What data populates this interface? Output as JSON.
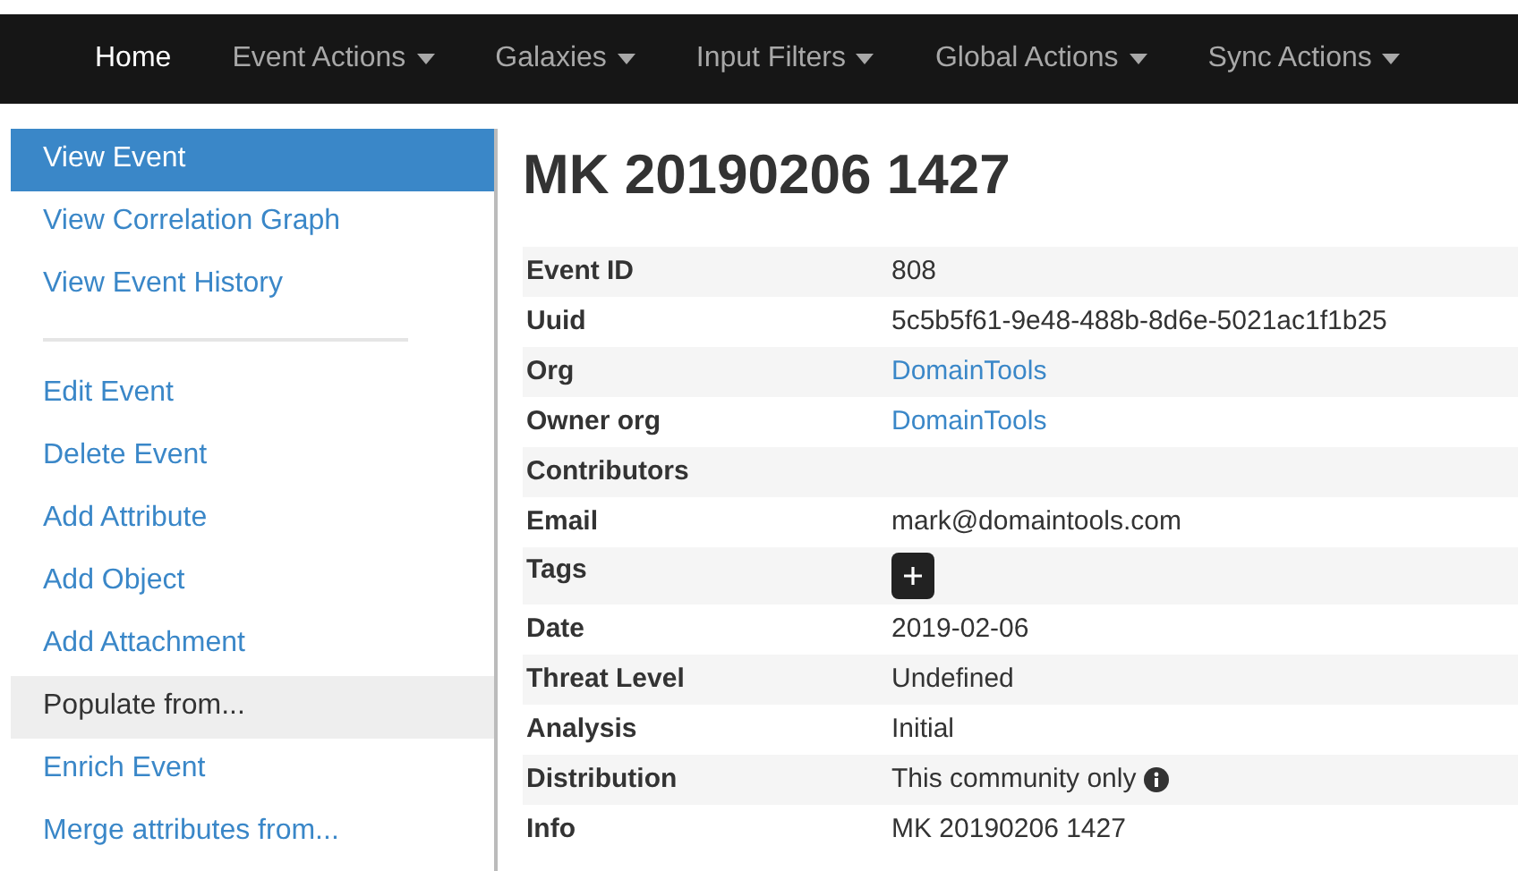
{
  "navbar": {
    "items": [
      {
        "label": "Home",
        "selected": true,
        "dropdown": false
      },
      {
        "label": "Event Actions",
        "selected": false,
        "dropdown": true
      },
      {
        "label": "Galaxies",
        "selected": false,
        "dropdown": true
      },
      {
        "label": "Input Filters",
        "selected": false,
        "dropdown": true
      },
      {
        "label": "Global Actions",
        "selected": false,
        "dropdown": true
      },
      {
        "label": "Sync Actions",
        "selected": false,
        "dropdown": true
      }
    ]
  },
  "sidebar": {
    "items": [
      {
        "kind": "link",
        "label": "View Event",
        "selected": true,
        "highlighted": false
      },
      {
        "kind": "link",
        "label": "View Correlation Graph",
        "selected": false,
        "highlighted": false
      },
      {
        "kind": "link",
        "label": "View Event History",
        "selected": false,
        "highlighted": false
      },
      {
        "kind": "divider"
      },
      {
        "kind": "link",
        "label": "Edit Event",
        "selected": false,
        "highlighted": false
      },
      {
        "kind": "link",
        "label": "Delete Event",
        "selected": false,
        "highlighted": false
      },
      {
        "kind": "link",
        "label": "Add Attribute",
        "selected": false,
        "highlighted": false
      },
      {
        "kind": "link",
        "label": "Add Object",
        "selected": false,
        "highlighted": false
      },
      {
        "kind": "link",
        "label": "Add Attachment",
        "selected": false,
        "highlighted": false
      },
      {
        "kind": "link",
        "label": "Populate from...",
        "selected": false,
        "highlighted": true
      },
      {
        "kind": "link",
        "label": "Enrich Event",
        "selected": false,
        "highlighted": false
      },
      {
        "kind": "link",
        "label": "Merge attributes from...",
        "selected": false,
        "highlighted": false
      }
    ]
  },
  "title": "MK 20190206 1427",
  "details": [
    {
      "kind": "text",
      "label": "Event ID",
      "value": "808"
    },
    {
      "kind": "text",
      "label": "Uuid",
      "value": "5c5b5f61-9e48-488b-8d6e-5021ac1f1b25"
    },
    {
      "kind": "link",
      "label": "Org",
      "value": "DomainTools"
    },
    {
      "kind": "link",
      "label": "Owner org",
      "value": "DomainTools"
    },
    {
      "kind": "empty",
      "label": "Contributors"
    },
    {
      "kind": "text",
      "label": "Email",
      "value": "mark@domaintools.com"
    },
    {
      "kind": "tags",
      "label": "Tags"
    },
    {
      "kind": "text",
      "label": "Date",
      "value": "2019-02-06"
    },
    {
      "kind": "text",
      "label": "Threat Level",
      "value": "Undefined"
    },
    {
      "kind": "text",
      "label": "Analysis",
      "value": "Initial"
    },
    {
      "kind": "info",
      "label": "Distribution",
      "value": "This community only"
    },
    {
      "kind": "text",
      "label": "Info",
      "value": "MK 20190206 1427"
    }
  ]
}
